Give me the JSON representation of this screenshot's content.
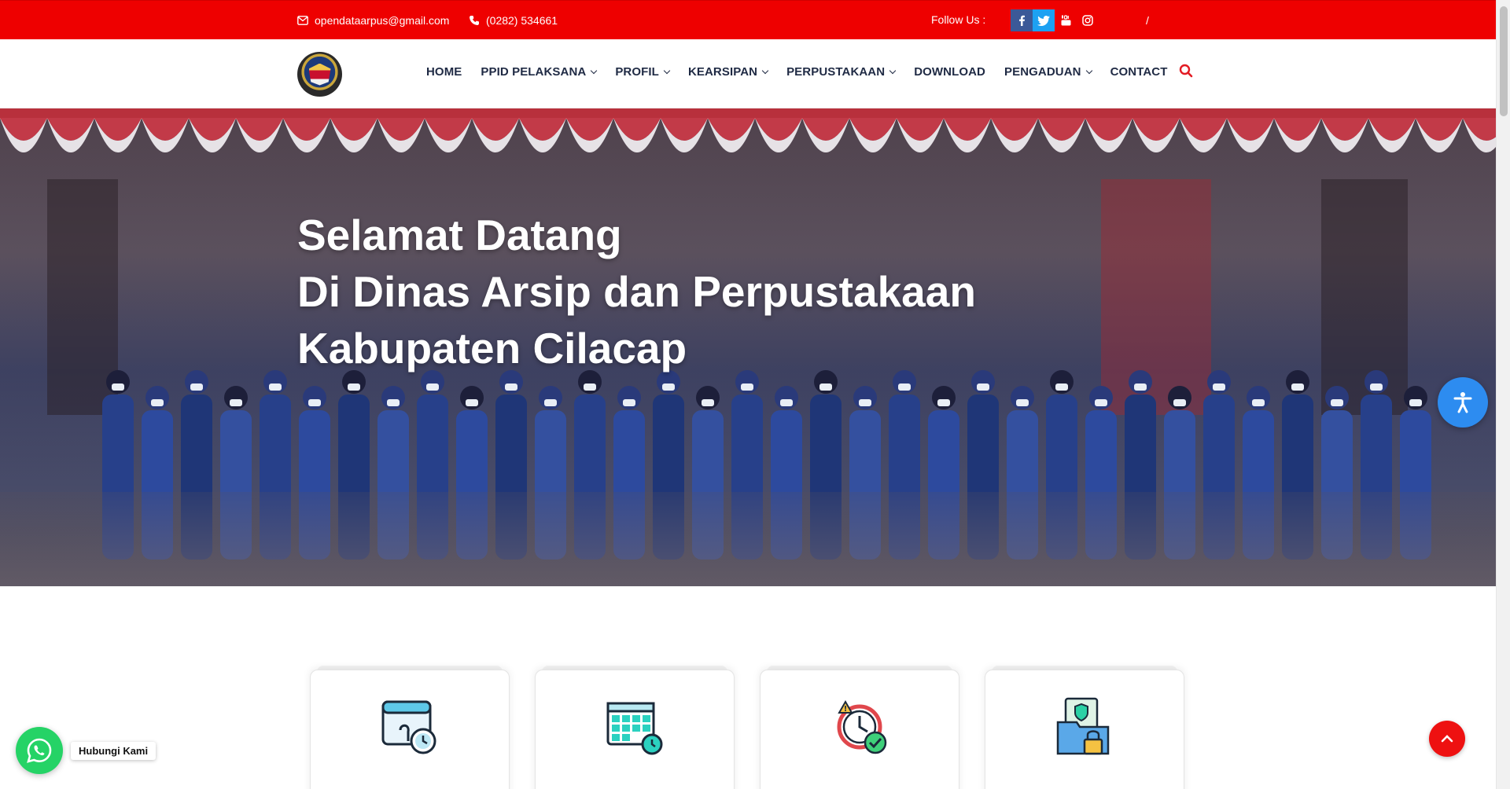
{
  "topbar": {
    "email": "opendataarpus@gmail.com",
    "phone": "(0282) 534661",
    "follow_label": "Follow Us :",
    "social_icons": [
      "facebook-icon",
      "twitter-icon",
      "youtube-icon",
      "instagram-icon"
    ],
    "separator": "/",
    "bg_color": "#ee0000"
  },
  "nav": {
    "items": [
      {
        "label": "HOME",
        "dropdown": false
      },
      {
        "label": "PPID PELAKSANA",
        "dropdown": true
      },
      {
        "label": "PROFIL",
        "dropdown": true
      },
      {
        "label": "KEARSIPAN",
        "dropdown": true
      },
      {
        "label": "PERPUSTAKAAN",
        "dropdown": true
      },
      {
        "label": "DOWNLOAD",
        "dropdown": false
      },
      {
        "label": "PENGADUAN",
        "dropdown": true
      },
      {
        "label": "CONTACT",
        "dropdown": false
      }
    ],
    "search_icon": "search-icon",
    "accent_color": "#e31b23"
  },
  "hero": {
    "line1": "Selamat Datang",
    "line2": "Di Dinas Arsip dan Perpustakaan",
    "line3": "Kabupaten Cilacap"
  },
  "cards": [
    {
      "icon": "calendar-clock-icon"
    },
    {
      "icon": "calendar-grid-icon"
    },
    {
      "icon": "alarm-check-icon"
    },
    {
      "icon": "secure-folder-icon"
    }
  ],
  "widgets": {
    "whatsapp_label": "Hubungi Kami",
    "accessibility_icon": "accessibility-icon",
    "back_to_top_icon": "chevron-up-icon"
  }
}
